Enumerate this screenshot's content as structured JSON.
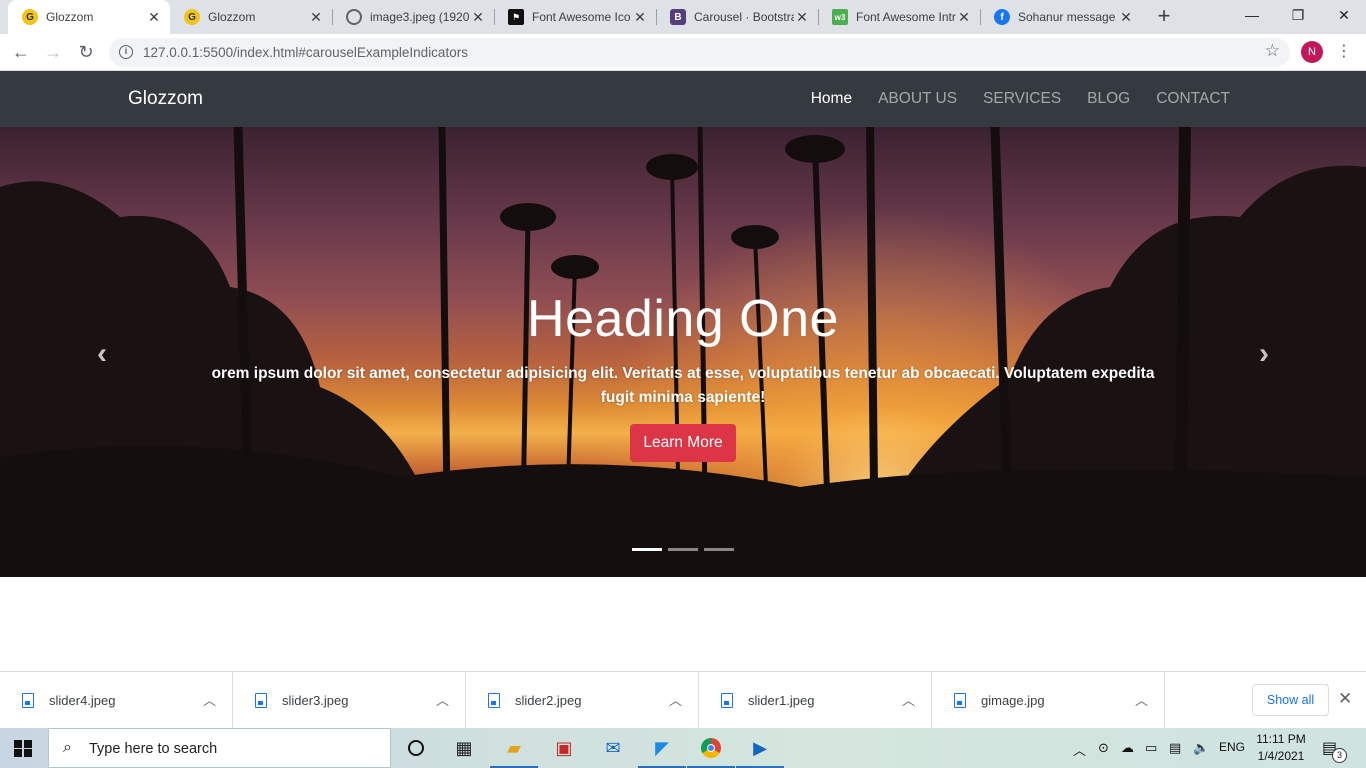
{
  "browser": {
    "tabs": [
      {
        "title": "Glozzom",
        "favicon": "G",
        "favicon_bg": "#f0c419",
        "active": true
      },
      {
        "title": "Glozzom",
        "favicon": "G",
        "favicon_bg": "#f0c419",
        "active": false
      },
      {
        "title": "image3.jpeg (1920",
        "favicon": "globe-icon",
        "active": false
      },
      {
        "title": "Font Awesome Ico",
        "favicon": "flag-icon",
        "active": false
      },
      {
        "title": "Carousel · Bootstra",
        "favicon": "B",
        "favicon_bg": "#563d7c",
        "active": false
      },
      {
        "title": "Font Awesome Intr",
        "favicon": "w3",
        "favicon_bg": "#4caf50",
        "active": false
      },
      {
        "title": "Sohanur message",
        "favicon": "f",
        "favicon_bg": "#1877f2",
        "active": false
      }
    ],
    "url": "127.0.0.1:5500/index.html#carouselExampleIndicators",
    "profile_initial": "N"
  },
  "site": {
    "brand": "Glozzom",
    "nav": [
      "Home",
      "ABOUT US",
      "SERVICES",
      "BLOG",
      "CONTACT"
    ],
    "carousel": {
      "heading": "Heading One",
      "text": "orem ipsum dolor sit amet, consectetur adipisicing elit. Veritatis at esse, voluptatibus tenetur ab obcaecati. Voluptatem expedita fugit minima sapiente!",
      "button": "Learn More",
      "slides": 3,
      "active_slide": 1,
      "button_color": "#dc3545"
    }
  },
  "downloads": {
    "items": [
      "slider4.jpeg",
      "slider3.jpeg",
      "slider2.jpeg",
      "slider1.jpeg",
      "gimage.jpg"
    ],
    "show_all": "Show all"
  },
  "taskbar": {
    "search_placeholder": "Type here to search",
    "language": "ENG",
    "time": "11:11 PM",
    "date": "1/4/2021",
    "notifications": "3"
  }
}
